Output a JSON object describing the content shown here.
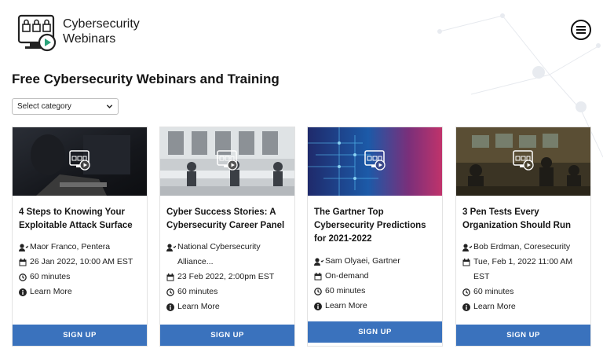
{
  "site": {
    "brand_line1": "Cybersecurity",
    "brand_line2": "Webinars"
  },
  "page": {
    "title": "Free Cybersecurity Webinars and Training"
  },
  "filter": {
    "selected": "Select category"
  },
  "colors": {
    "accent": "#3a72bd"
  },
  "cards": [
    {
      "title": "4 Steps to Knowing Your Exploitable Attack Surface",
      "speaker": "Maor Franco, Pentera",
      "date": "26 Jan 2022, 10:00 AM EST",
      "duration": "60 minutes",
      "learn_more": "Learn More",
      "signup": "SIGN UP"
    },
    {
      "title": "Cyber Success Stories: A Cybersecurity Career Panel",
      "speaker": "National Cybersecurity Alliance...",
      "date": "23 Feb 2022, 2:00pm EST",
      "duration": "60 minutes",
      "learn_more": "Learn More",
      "signup": "SIGN UP"
    },
    {
      "title": "The Gartner Top Cybersecurity Predictions for 2021-2022",
      "speaker": "Sam Olyaei, Gartner",
      "date": "On-demand",
      "duration": "60 minutes",
      "learn_more": "Learn More",
      "signup": "SIGN UP"
    },
    {
      "title": "3 Pen Tests Every Organization Should Run",
      "speaker": "Bob Erdman, Coresecurity",
      "date": "Tue, Feb 1, 2022 11:00 AM EST",
      "duration": "60 minutes",
      "learn_more": "Learn More",
      "signup": "SIGN UP"
    }
  ]
}
